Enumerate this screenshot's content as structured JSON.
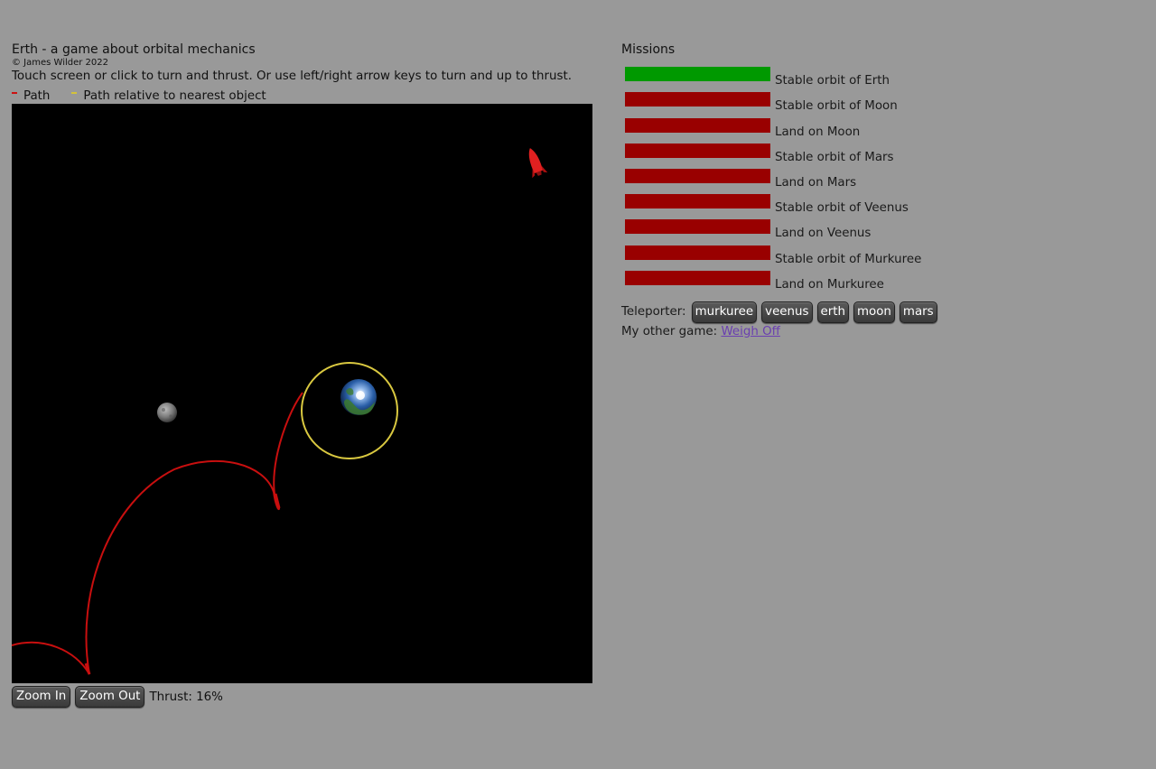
{
  "header": {
    "title": "Erth - a game about orbital mechanics",
    "copyright": "© James Wilder 2022",
    "instructions": "Touch screen or click to turn and thrust. Or use left/right arrow keys to turn and up to thrust."
  },
  "legend": {
    "path_label": "Path",
    "path_color": "#cc1111",
    "relative_label": "Path relative to nearest object",
    "relative_color": "#d4c23a"
  },
  "controls": {
    "zoom_in_label": "Zoom In",
    "zoom_out_label": "Zoom Out",
    "thrust_label": "Thrust: 16%",
    "thrust_percent": 16
  },
  "missions": {
    "heading": "Missions",
    "complete_color": "#009900",
    "incomplete_color": "#990000",
    "items": [
      {
        "label": "Stable orbit of Erth",
        "complete": true
      },
      {
        "label": "Stable orbit of Moon",
        "complete": false
      },
      {
        "label": "Land on Moon",
        "complete": false
      },
      {
        "label": "Stable orbit of Mars",
        "complete": false
      },
      {
        "label": "Land on Mars",
        "complete": false
      },
      {
        "label": "Stable orbit of Veenus",
        "complete": false
      },
      {
        "label": "Land on Veenus",
        "complete": false
      },
      {
        "label": "Stable orbit of Murkuree",
        "complete": false
      },
      {
        "label": "Land on Murkuree",
        "complete": false
      }
    ]
  },
  "teleporter": {
    "label": "Teleporter:",
    "destinations": [
      "murkuree",
      "veenus",
      "erth",
      "moon",
      "mars"
    ]
  },
  "other_game": {
    "prefix": "My other game:",
    "link_text": "Weigh Off"
  }
}
